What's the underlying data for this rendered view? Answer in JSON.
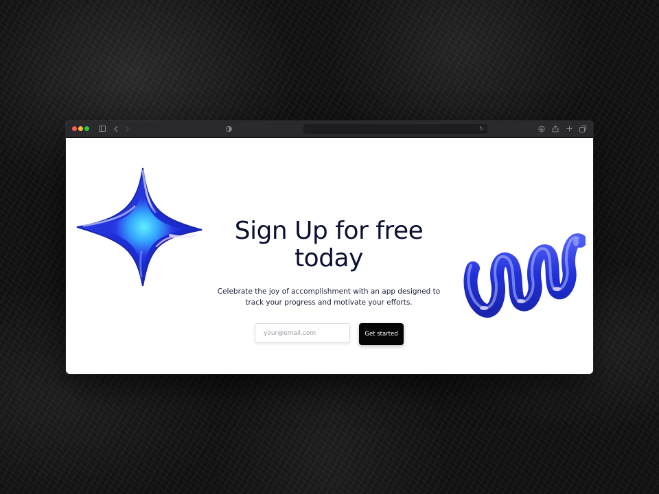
{
  "window": {
    "address_placeholder": ""
  },
  "toolbar": {
    "icons": [
      "sidebar-icon",
      "back-chevron-icon",
      "forward-chevron-icon",
      "shield-icon",
      "reload-icon",
      "download-icon",
      "share-icon",
      "new-tab-icon",
      "tabs-overview-icon"
    ]
  },
  "hero": {
    "title": "Sign Up for free today",
    "subtitle": "Celebrate the joy of accomplishment with an app designed to track your progress and motivate your efforts.",
    "email_placeholder": "your@email.com",
    "cta_label": "Get started"
  },
  "colors": {
    "title": "#0b1033",
    "cta_bg": "#050505",
    "accent_blue": "#2a3bd6"
  }
}
